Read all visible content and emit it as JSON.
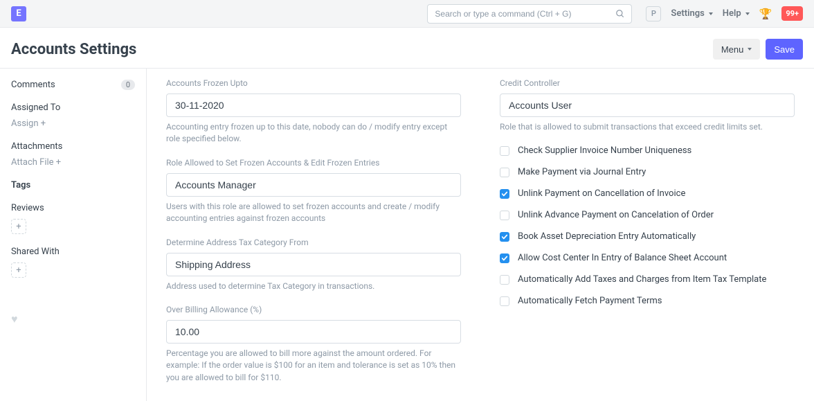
{
  "topbar": {
    "brand_letter": "E",
    "search_placeholder": "Search or type a command (Ctrl + G)",
    "p_badge": "P",
    "settings_label": "Settings",
    "help_label": "Help",
    "notification_count": "99+"
  },
  "header": {
    "title": "Accounts Settings",
    "menu_label": "Menu",
    "save_label": "Save"
  },
  "sidebar": {
    "comments_label": "Comments",
    "comments_count": "0",
    "assigned_to_label": "Assigned To",
    "assign_action": "Assign +",
    "attachments_label": "Attachments",
    "attach_action": "Attach File +",
    "tags_label": "Tags",
    "reviews_label": "Reviews",
    "shared_with_label": "Shared With"
  },
  "left_col": {
    "frozen_upto": {
      "label": "Accounts Frozen Upto",
      "value": "30-11-2020",
      "help": "Accounting entry frozen up to this date, nobody can do / modify entry except role specified below."
    },
    "role_frozen": {
      "label": "Role Allowed to Set Frozen Accounts & Edit Frozen Entries",
      "value": "Accounts Manager",
      "help": "Users with this role are allowed to set frozen accounts and create / modify accounting entries against frozen accounts"
    },
    "tax_category": {
      "label": "Determine Address Tax Category From",
      "value": "Shipping Address",
      "help": "Address used to determine Tax Category in transactions."
    },
    "over_billing": {
      "label": "Over Billing Allowance (%)",
      "value": "10.00",
      "help": "Percentage you are allowed to bill more against the amount ordered. For example: If the order value is $100 for an item and tolerance is set as 10% then you are allowed to bill for $110."
    }
  },
  "right_col": {
    "credit_controller": {
      "label": "Credit Controller",
      "value": "Accounts User",
      "help": "Role that is allowed to submit transactions that exceed credit limits set."
    },
    "checks": [
      {
        "label": "Check Supplier Invoice Number Uniqueness",
        "checked": false,
        "name": "check-supplier-invoice-uniqueness"
      },
      {
        "label": "Make Payment via Journal Entry",
        "checked": false,
        "name": "make-payment-via-journal-entry"
      },
      {
        "label": "Unlink Payment on Cancellation of Invoice",
        "checked": true,
        "name": "unlink-payment-on-cancel-invoice"
      },
      {
        "label": "Unlink Advance Payment on Cancelation of Order",
        "checked": false,
        "name": "unlink-advance-payment-on-cancel-order"
      },
      {
        "label": "Book Asset Depreciation Entry Automatically",
        "checked": true,
        "name": "book-asset-depreciation-auto"
      },
      {
        "label": "Allow Cost Center In Entry of Balance Sheet Account",
        "checked": true,
        "name": "allow-cost-center-balance-sheet"
      },
      {
        "label": "Automatically Add Taxes and Charges from Item Tax Template",
        "checked": false,
        "name": "auto-add-taxes-from-template"
      },
      {
        "label": "Automatically Fetch Payment Terms",
        "checked": false,
        "name": "auto-fetch-payment-terms"
      }
    ]
  }
}
